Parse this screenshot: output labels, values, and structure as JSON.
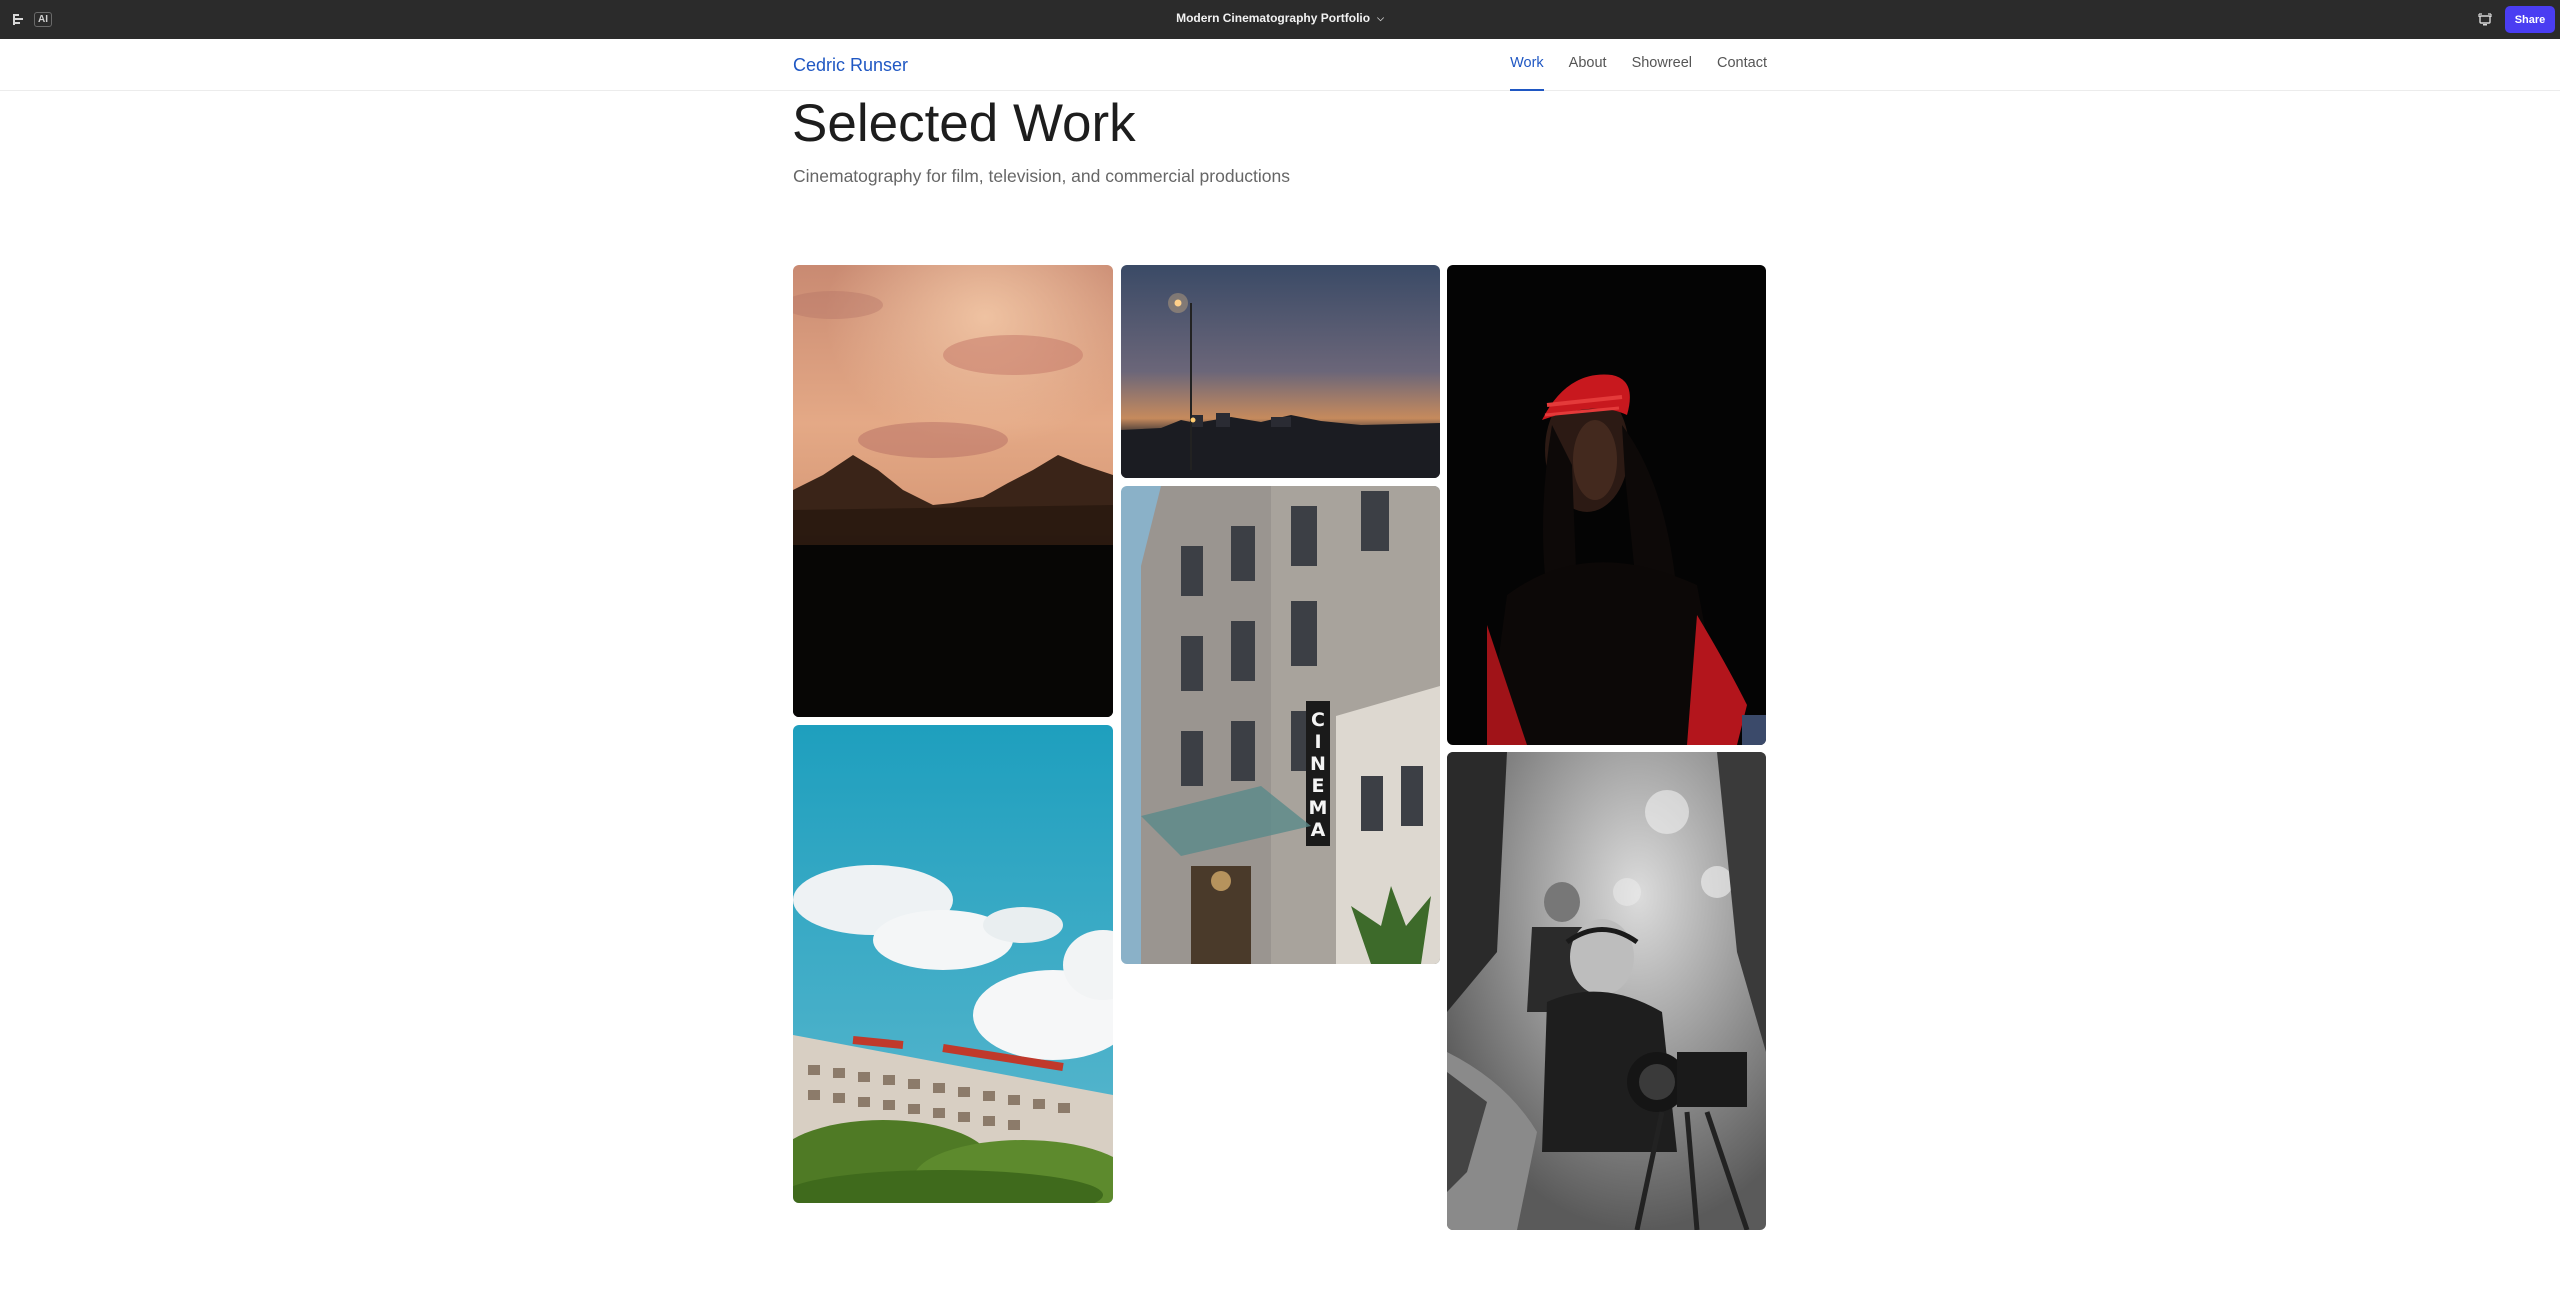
{
  "appbar": {
    "ai_label": "AI",
    "project_title": "Modern Cinematography Portfolio",
    "share_label": "Share"
  },
  "site": {
    "brand": "Cedric Runser",
    "nav": [
      {
        "label": "Work",
        "active": true
      },
      {
        "label": "About",
        "active": false
      },
      {
        "label": "Showreel",
        "active": false
      },
      {
        "label": "Contact",
        "active": false
      }
    ]
  },
  "hero": {
    "title": "Selected Work",
    "subtitle": "Cinematography for film, television, and commercial productions"
  },
  "gallery": {
    "sign_text": "CINEMA"
  },
  "colors": {
    "accent": "#1f57c3",
    "share_button": "#4a3df2",
    "appbar_bg": "#2b2b2b"
  }
}
